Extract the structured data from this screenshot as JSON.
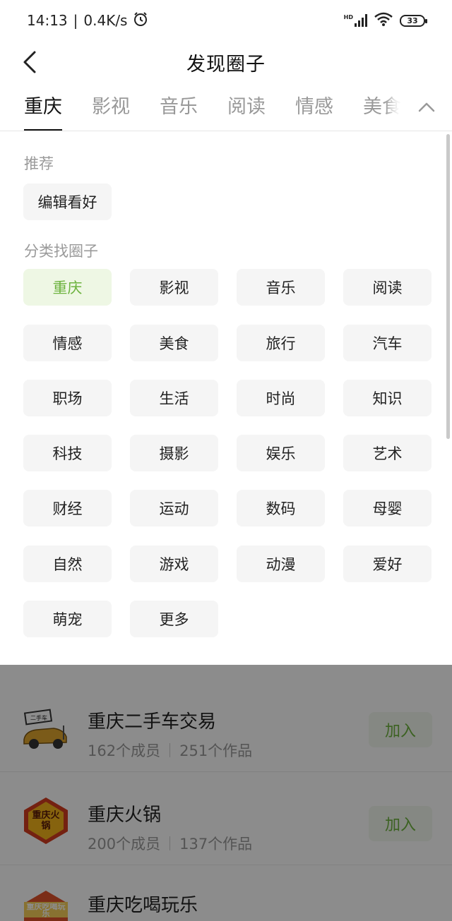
{
  "status_bar": {
    "time": "14:13",
    "speed": "0.4K/s",
    "network_label": "HD",
    "battery": "33"
  },
  "header": {
    "title": "发现圈子"
  },
  "tabs": [
    {
      "label": "重庆",
      "active": true
    },
    {
      "label": "影视",
      "active": false
    },
    {
      "label": "音乐",
      "active": false
    },
    {
      "label": "阅读",
      "active": false
    },
    {
      "label": "情感",
      "active": false
    },
    {
      "label": "美食",
      "active": false
    }
  ],
  "panel": {
    "recommend_label": "推荐",
    "recommend_chip": "编辑看好",
    "category_label": "分类找圈子",
    "categories": [
      {
        "label": "重庆",
        "selected": true
      },
      {
        "label": "影视"
      },
      {
        "label": "音乐"
      },
      {
        "label": "阅读"
      },
      {
        "label": "情感"
      },
      {
        "label": "美食"
      },
      {
        "label": "旅行"
      },
      {
        "label": "汽车"
      },
      {
        "label": "职场"
      },
      {
        "label": "生活"
      },
      {
        "label": "时尚"
      },
      {
        "label": "知识"
      },
      {
        "label": "科技"
      },
      {
        "label": "摄影"
      },
      {
        "label": "娱乐"
      },
      {
        "label": "艺术"
      },
      {
        "label": "财经"
      },
      {
        "label": "运动"
      },
      {
        "label": "数码"
      },
      {
        "label": "母婴"
      },
      {
        "label": "自然"
      },
      {
        "label": "游戏"
      },
      {
        "label": "动漫"
      },
      {
        "label": "爱好"
      },
      {
        "label": "萌宠"
      },
      {
        "label": "更多"
      }
    ]
  },
  "list": {
    "items": [
      {
        "name": "重庆二手车交易",
        "members": "162个成员",
        "works": "251个作品",
        "button": "加入",
        "thumb_text": "二手车"
      },
      {
        "name": "重庆火锅",
        "members": "200个成员",
        "works": "137个作品",
        "button": "加入",
        "thumb_text": "重庆火锅"
      },
      {
        "name": "重庆吃喝玩乐",
        "members": "",
        "works": "",
        "button": "",
        "thumb_text": "重庆吃喝玩乐"
      }
    ]
  },
  "colors": {
    "accent_green": "#6db33f",
    "selected_chip_bg": "#eef7e4",
    "chip_bg": "#f5f5f5"
  }
}
